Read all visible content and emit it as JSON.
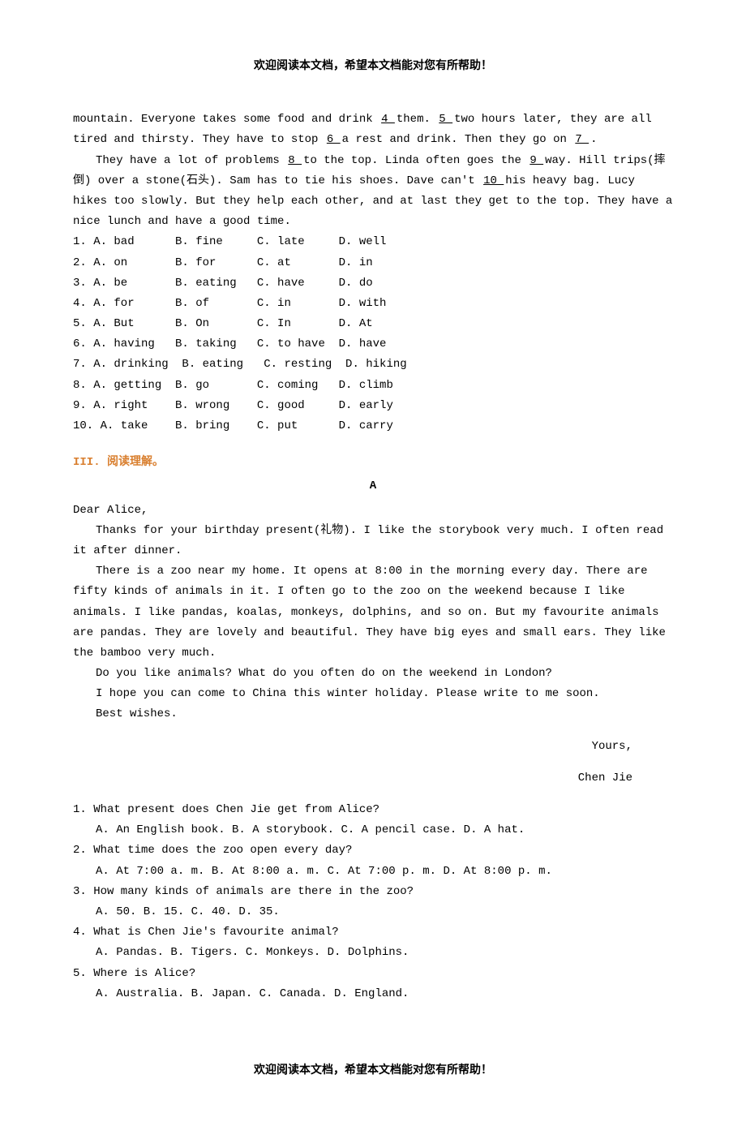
{
  "header": "欢迎阅读本文档，希望本文档能对您有所帮助！",
  "footer": "欢迎阅读本文档，希望本文档能对您有所帮助！",
  "cloze": {
    "p1_a": "mountain. Everyone takes some food and drink ",
    "b4": "  4  ",
    "p1_b": " them. ",
    "b5": "  5  ",
    "p1_c": " two hours later, they are all tired and thirsty. They have to stop ",
    "b6": "  6  ",
    "p1_d": " a rest and drink. Then they go on ",
    "b7": "  7  ",
    "p1_e": ".",
    "p2_a": "They have a lot of problems ",
    "b8": "  8  ",
    "p2_b": " to the top. Linda often goes the ",
    "b9": "  9  ",
    "p2_c": " way. Hill trips(摔倒) over a stone(石头). Sam has to tie his shoes. Dave can't ",
    "b10": "  10  ",
    "p2_d": " his heavy bag. Lucy hikes too slowly. But they help each other, and at last they get to the top. They have a nice lunch and have a good time.",
    "rows": [
      "1. A. bad      B. fine     C. late     D. well",
      "2. A. on       B. for      C. at       D. in",
      "3. A. be       B. eating   C. have     D. do",
      "4. A. for      B. of       C. in       D. with",
      "5. A. But      B. On       C. In       D. At",
      "6. A. having   B. taking   C. to have  D. have",
      "7. A. drinking  B. eating   C. resting  D. hiking",
      "8. A. getting  B. go       C. coming   D. climb",
      "9. A. right    B. wrong    C. good     D. early",
      "10. A. take    B. bring    C. put      D. carry"
    ]
  },
  "reading": {
    "section": "III. 阅读理解。",
    "title": "A",
    "greeting": "Dear Alice,",
    "p1": "Thanks for your birthday present(礼物). I like the storybook very much. I often read it after dinner.",
    "p2": "There is a zoo near my home. It opens at 8:00 in the morning every day. There are fifty kinds of animals in it. I often go to the zoo on the weekend because I like animals. I like pandas, koalas, monkeys, dolphins, and so on. But my favourite animals are pandas. They are lovely and beautiful. They have big eyes and small ears. They like the bamboo very much.",
    "p3": "Do you like animals? What do you often do on the weekend in London?",
    "p4": "I hope you can come to China this winter holiday. Please write to me soon.",
    "p5": "Best wishes.",
    "sign1": "Yours,",
    "sign2": "Chen Jie",
    "qs": [
      {
        "q": "1. What present does Chen Jie get from Alice?",
        "o": "A. An English book.   B. A storybook.    C. A pencil case.    D. A hat."
      },
      {
        "q": "2. What time does the zoo open every day?",
        "o": "A. At 7:00 a. m.    B. At 8:00 a. m.    C. At 7:00 p. m.    D. At 8:00 p. m."
      },
      {
        "q": "3. How many kinds of animals are there in the zoo?",
        "o": "A. 50.    B. 15.    C. 40.    D. 35."
      },
      {
        "q": "4. What is Chen Jie's favourite animal?",
        "o": "A. Pandas.    B. Tigers.    C. Monkeys.    D. Dolphins."
      },
      {
        "q": "5. Where is Alice?",
        "o": "A. Australia.    B. Japan.    C. Canada.    D. England."
      }
    ]
  }
}
